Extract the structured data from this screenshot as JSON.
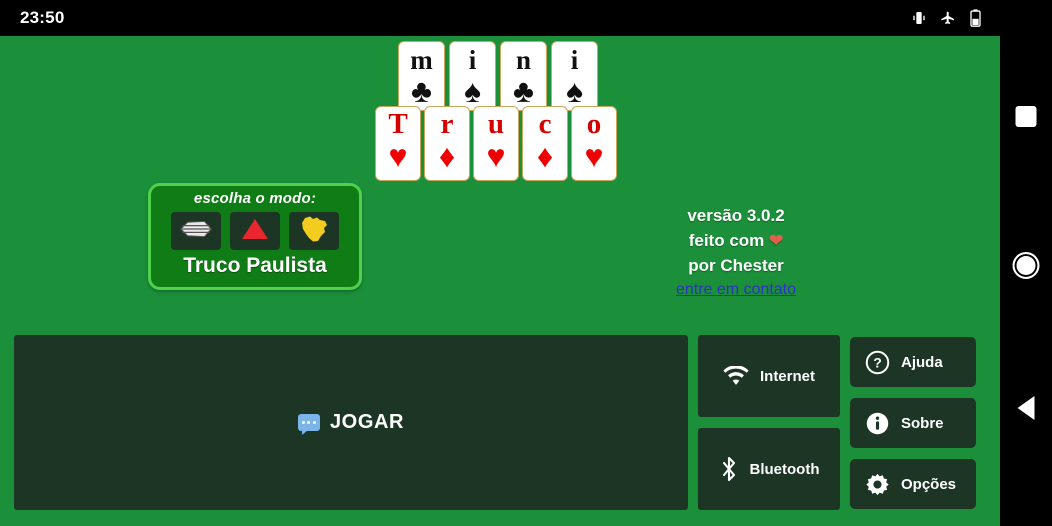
{
  "status_bar": {
    "time": "23:50",
    "icons": [
      "vibrate-icon",
      "airplane-mode-icon",
      "battery-icon"
    ]
  },
  "nav_bar": {
    "recents": "recents-square",
    "home": "home-circle",
    "back": "back-triangle"
  },
  "logo": {
    "top_cards": [
      {
        "letter": "m",
        "pip": "♣",
        "suit": "clubs",
        "color": "#111111"
      },
      {
        "letter": "i",
        "pip": "♠",
        "suit": "spades",
        "color": "#111111"
      },
      {
        "letter": "n",
        "pip": "♣",
        "suit": "clubs",
        "color": "#111111"
      },
      {
        "letter": "i",
        "pip": "♠",
        "suit": "spades",
        "color": "#111111"
      }
    ],
    "bottom_cards": [
      {
        "letter": "T",
        "pip": "♥",
        "suit": "hearts",
        "color": "#ee0000"
      },
      {
        "letter": "r",
        "pip": "♦",
        "suit": "diamonds",
        "color": "#ee0000"
      },
      {
        "letter": "u",
        "pip": "♥",
        "suit": "hearts",
        "color": "#ee0000"
      },
      {
        "letter": "c",
        "pip": "♦",
        "suit": "diamonds",
        "color": "#ee0000"
      },
      {
        "letter": "o",
        "pip": "♥",
        "suit": "hearts",
        "color": "#ee0000"
      }
    ],
    "word": "mini Truco"
  },
  "mode_selector": {
    "title": "escolha o modo:",
    "options": [
      {
        "name": "paulista",
        "icon": "sao-paulo-flag-icon",
        "selected": true
      },
      {
        "name": "mineiro",
        "icon": "minas-gerais-triangle-icon",
        "selected": false
      },
      {
        "name": "brasil",
        "icon": "brazil-map-icon",
        "selected": false
      }
    ],
    "selected_label": "Truco Paulista"
  },
  "version_info": {
    "version_line": "versão 3.0.2",
    "made_with": "feito com",
    "heart": "❤",
    "author_line": "por Chester",
    "contact_link": "entre em contato",
    "link_color": "#2f30c4"
  },
  "buttons": {
    "play": {
      "label": "JOGAR",
      "icon": "chat-bubble-icon"
    },
    "internet": {
      "label": "Internet",
      "icon": "wifi-icon"
    },
    "bluetooth": {
      "label": "Bluetooth",
      "icon": "bluetooth-icon"
    },
    "help": {
      "label": "Ajuda",
      "icon": "question-circle-icon"
    },
    "about": {
      "label": "Sobre",
      "icon": "info-circle-icon"
    },
    "options": {
      "label": "Opções",
      "icon": "gear-icon"
    }
  },
  "colors": {
    "table_green": "#1b8f3a",
    "dark_button": "#1c3524",
    "mode_box_green": "#107c16",
    "mode_box_border": "#4fd14f",
    "card_red": "#ee0000",
    "heart_emoji": "#e0604a"
  }
}
